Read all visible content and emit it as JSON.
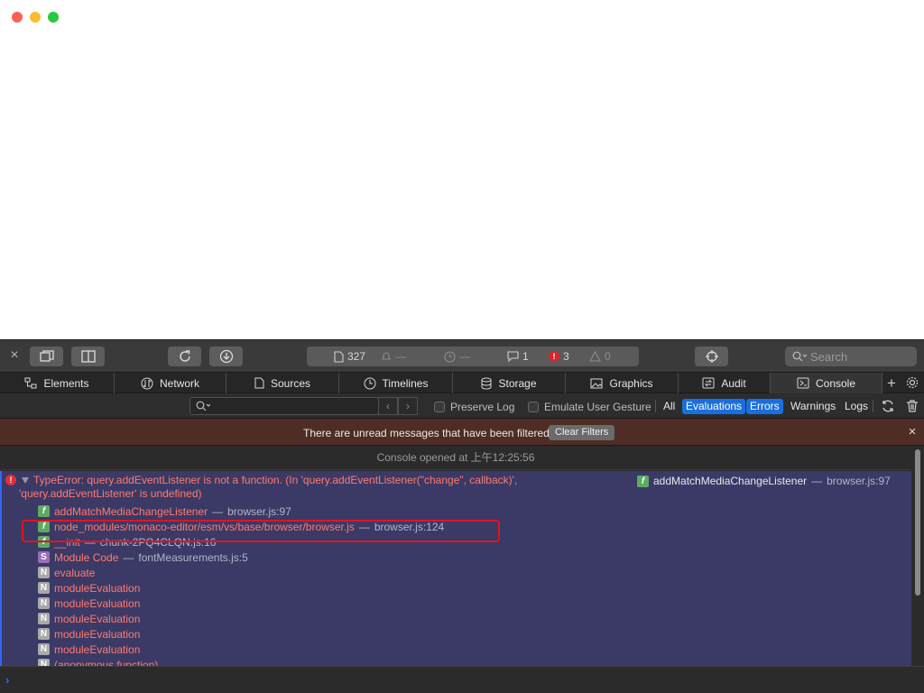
{
  "window": {
    "traffic_colors": [
      "#fe5f57",
      "#febc2e",
      "#28c840"
    ]
  },
  "toolbar": {
    "resources_count": "327",
    "requests_placeholder": "—",
    "time_placeholder": "—",
    "messages_count": "1",
    "errors_count": "3",
    "warnings_count": "0",
    "search_placeholder": "Search"
  },
  "tabs": [
    {
      "label": "Elements",
      "icon": "elements-icon"
    },
    {
      "label": "Network",
      "icon": "network-icon"
    },
    {
      "label": "Sources",
      "icon": "sources-icon"
    },
    {
      "label": "Timelines",
      "icon": "timelines-icon"
    },
    {
      "label": "Storage",
      "icon": "storage-icon"
    },
    {
      "label": "Graphics",
      "icon": "graphics-icon"
    },
    {
      "label": "Audit",
      "icon": "audit-icon"
    },
    {
      "label": "Console",
      "icon": "console-icon",
      "active": true
    }
  ],
  "filterbar": {
    "filter_value": "",
    "preserve_log": "Preserve Log",
    "emulate_gesture": "Emulate User Gesture",
    "levels": [
      {
        "label": "All",
        "active": false
      },
      {
        "label": "Evaluations",
        "active": true
      },
      {
        "label": "Errors",
        "active": true
      },
      {
        "label": "Warnings",
        "active": false
      },
      {
        "label": "Logs",
        "active": false
      }
    ]
  },
  "banner": {
    "text": "There are unread messages that have been filtered",
    "button": "Clear Filters"
  },
  "console": {
    "opened_text": "Console opened at 上午12:25:56",
    "error_message": "TypeError: query.addEventListener is not a function. (In 'query.addEventListener(\"change\", callback)', 'query.addEventListener' is undefined)",
    "error_source_name": "addMatchMediaChangeListener",
    "error_source_sep": "—",
    "error_source_loc": "browser.js:97",
    "frames": [
      {
        "badge": "f",
        "name": "addMatchMediaChangeListener",
        "sep": "—",
        "loc": "browser.js:97"
      },
      {
        "badge": "f",
        "name": "node_modules/monaco-editor/esm/vs/base/browser/browser.js",
        "sep": "—",
        "loc": "browser.js:124"
      },
      {
        "badge": "f",
        "name": "__init",
        "sep": "—",
        "loc": "chunk-2PQ4CLQN.js:16"
      },
      {
        "badge": "S",
        "name": "Module Code",
        "sep": "—",
        "loc": "fontMeasurements.js:5"
      },
      {
        "badge": "N",
        "name": "evaluate",
        "sep": "",
        "loc": ""
      },
      {
        "badge": "N",
        "name": "moduleEvaluation",
        "sep": "",
        "loc": ""
      },
      {
        "badge": "N",
        "name": "moduleEvaluation",
        "sep": "",
        "loc": ""
      },
      {
        "badge": "N",
        "name": "moduleEvaluation",
        "sep": "",
        "loc": ""
      },
      {
        "badge": "N",
        "name": "moduleEvaluation",
        "sep": "",
        "loc": ""
      },
      {
        "badge": "N",
        "name": "moduleEvaluation",
        "sep": "",
        "loc": ""
      },
      {
        "badge": "N",
        "name": "(anonymous function)",
        "sep": "",
        "loc": ""
      }
    ]
  },
  "prompt": {
    "chevron": "›",
    "value": ""
  }
}
